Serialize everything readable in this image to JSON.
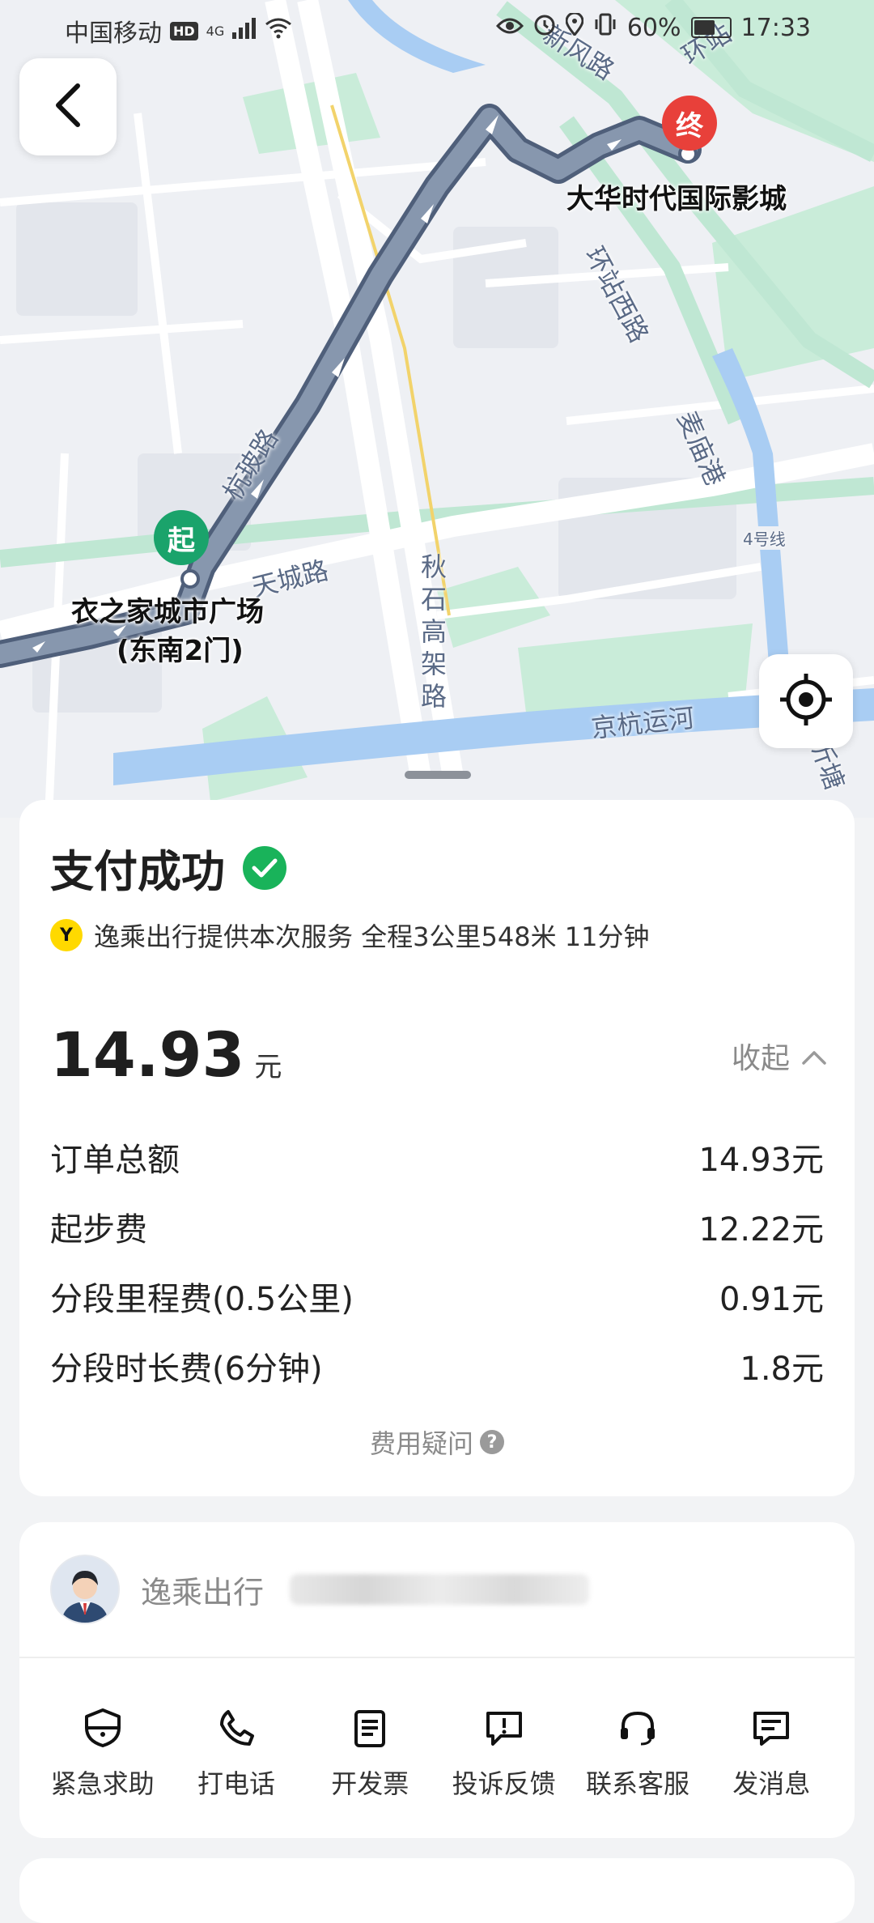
{
  "status_bar": {
    "carrier": "中国移动",
    "hd": "HD",
    "network": "4G",
    "battery": "60%",
    "battery_level": 0.6,
    "time": "17:33"
  },
  "map": {
    "start_pin": "起",
    "end_pin": "终",
    "start_place_line1": "衣之家城市广场",
    "start_place_line2": "(东南2门)",
    "end_place": "大华时代国际影城",
    "roads": {
      "xinfeng": "新风路",
      "huanzhan": "环站",
      "huanzhan_west": "环站西路",
      "hangjian": "杭玻路",
      "tiancheng": "天城路",
      "qiushi": "秋石高架路",
      "jinghang": "京杭运河",
      "maimiao": "麦庙港",
      "metro4": "4号线",
      "edge_road": "沂塘"
    }
  },
  "payment": {
    "title": "支付成功",
    "provider_logo": "Y",
    "service_info": "逸乘出行提供本次服务 全程3公里548米 11分钟",
    "total_amount": "14.93",
    "total_unit": "元",
    "collapse_label": "收起",
    "fees": [
      {
        "label": "订单总额",
        "value": "14.93元"
      },
      {
        "label": "起步费",
        "value": "12.22元"
      },
      {
        "label": "分段里程费(0.5公里)",
        "value": "0.91元"
      },
      {
        "label": "分段时长费(6分钟)",
        "value": "1.8元"
      }
    ],
    "fee_question": "费用疑问"
  },
  "driver": {
    "name": "逸乘出行"
  },
  "actions": [
    {
      "label": "紧急求助",
      "icon": "shield-icon"
    },
    {
      "label": "打电话",
      "icon": "phone-icon"
    },
    {
      "label": "开发票",
      "icon": "invoice-icon"
    },
    {
      "label": "投诉反馈",
      "icon": "complaint-icon"
    },
    {
      "label": "联系客服",
      "icon": "headset-icon"
    },
    {
      "label": "发消息",
      "icon": "message-icon"
    }
  ],
  "colors": {
    "route": "#7d8ea6",
    "success": "#19b35a",
    "start_pin": "#1aa36b",
    "end_pin": "#e8403a",
    "water": "#a9cdf3",
    "green": "#c9ecd9"
  }
}
